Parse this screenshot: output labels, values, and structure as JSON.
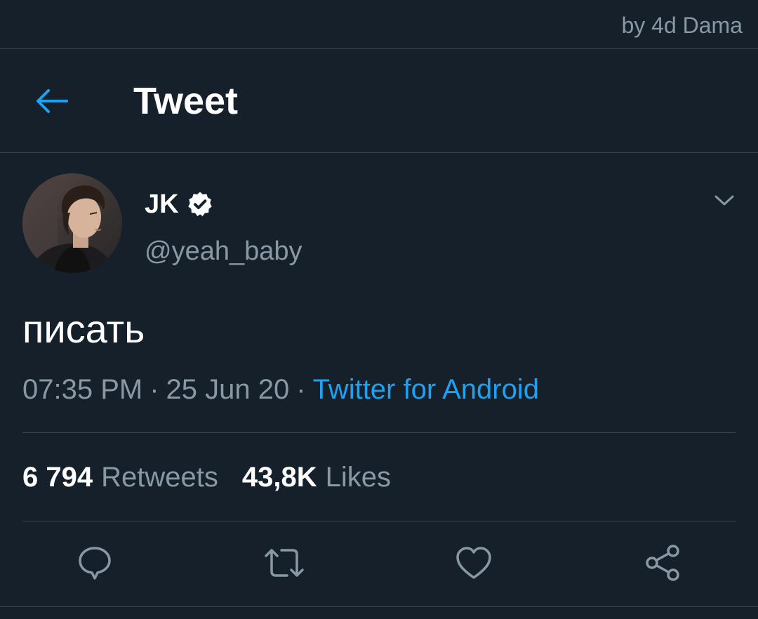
{
  "credit": "by 4d Dama",
  "header": {
    "title": "Tweet"
  },
  "tweet": {
    "author": {
      "name": "JK",
      "handle": "@yeah_baby",
      "verified": true
    },
    "text": "писать",
    "time": "07:35 PM",
    "date": "25 Jun 20",
    "separator": "·",
    "source": "Twitter for Android",
    "stats": {
      "retweets_count": "6 794",
      "retweets_label": "Retweets",
      "likes_count": "43,8K",
      "likes_label": "Likes"
    }
  },
  "icons": {
    "back": "arrow-left-icon",
    "verified": "verified-badge-icon",
    "caret": "chevron-down-icon",
    "reply": "reply-icon",
    "retweet": "retweet-icon",
    "like": "heart-icon",
    "share": "share-icon"
  },
  "colors": {
    "background": "#15202b",
    "accent": "#1da1f2",
    "secondary_text": "#8899a6",
    "divider": "#38444d",
    "primary_text": "#ffffff"
  }
}
